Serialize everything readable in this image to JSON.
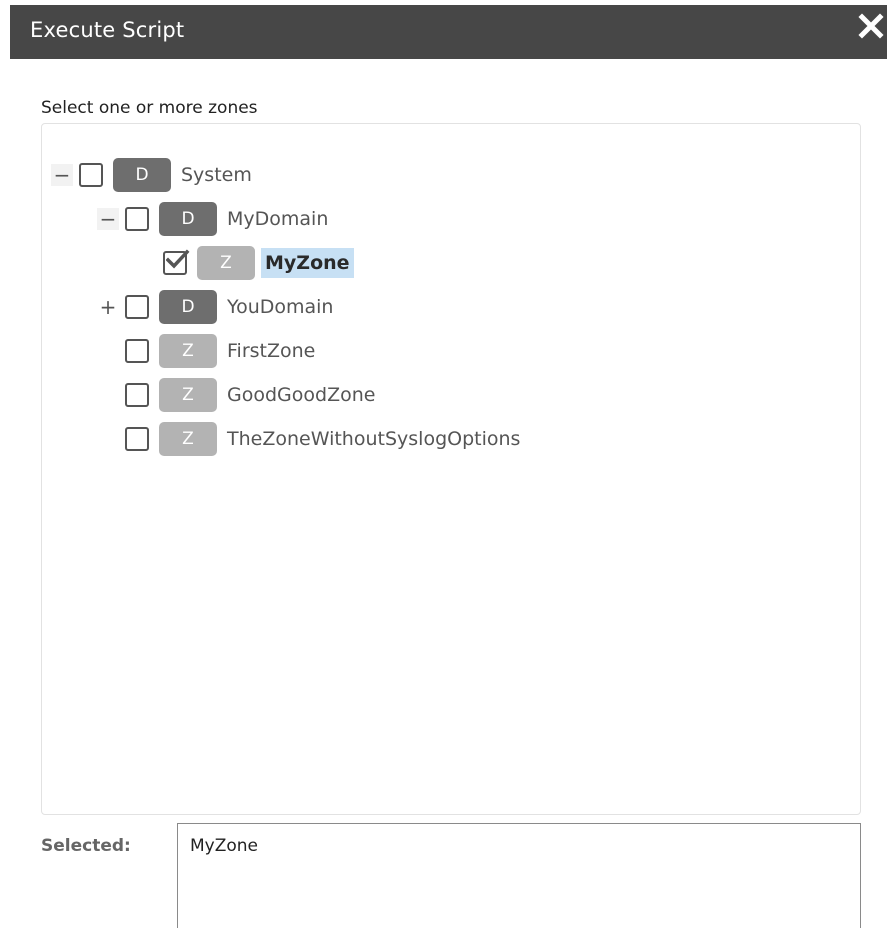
{
  "dialog": {
    "title": "Execute Script",
    "close_icon": "close-icon"
  },
  "instruction": "Select one or more zones",
  "tree": {
    "nodes": [
      {
        "label": "System",
        "badge": "D",
        "type": "domain",
        "toggle": "−",
        "checked": false
      },
      {
        "label": "MyDomain",
        "badge": "D",
        "type": "domain",
        "toggle": "−",
        "checked": false
      },
      {
        "label": "MyZone",
        "badge": "Z",
        "type": "zone",
        "toggle": "",
        "checked": true,
        "selected": true
      },
      {
        "label": "YouDomain",
        "badge": "D",
        "type": "domain",
        "toggle": "+",
        "checked": false
      },
      {
        "label": "FirstZone",
        "badge": "Z",
        "type": "zone",
        "toggle": "",
        "checked": false
      },
      {
        "label": "GoodGoodZone",
        "badge": "Z",
        "type": "zone",
        "toggle": "",
        "checked": false
      },
      {
        "label": "TheZoneWithoutSyslogOptions",
        "badge": "Z",
        "type": "zone",
        "toggle": "",
        "checked": false
      }
    ]
  },
  "selected": {
    "label": "Selected:",
    "value": "MyZone"
  },
  "colors": {
    "titlebar": "#474747",
    "domain_badge": "#6e6e6e",
    "zone_badge": "#b3b3b3",
    "selection_highlight": "#c7e0f4"
  }
}
